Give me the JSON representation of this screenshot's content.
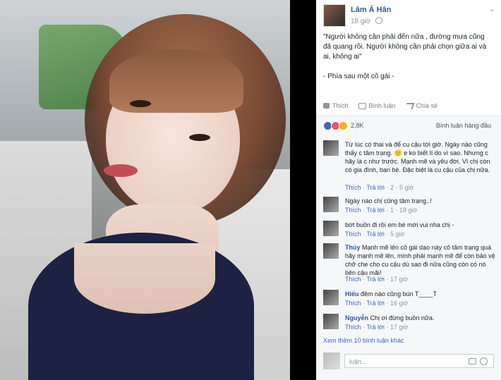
{
  "post": {
    "author": "Lâm Á Hân",
    "time": "18 giờ",
    "content": "\"Người không cần phải đến nữa , đường mưa cũng đã quang rồi. Người không cần phải chọn giữa ai và ai, không ai\"",
    "signature": "- Phía sau một cô gái -",
    "actions": {
      "like": "Thích",
      "comment": "Bình luận",
      "share": "Chia sẻ"
    },
    "reactions_count": "2,8K",
    "sort_label": "Bình luận hàng đầu",
    "chevron": "⌄"
  },
  "comments": [
    {
      "name": "",
      "text": "Từ lúc có thai và để cu cậu tới giờ. Ngày nào cũng thấy c tâm trạng. 🙂 e ko biết lí do vì sao. Nhưng c hãy là c như trước. Mạnh mẽ và yêu đời. Vì chị còn có gia đình, bạn bè. Đặc biệt là cu cậu của chị nữa.",
      "like": "Thích",
      "reply": "Trả lời",
      "likes": "2",
      "time": "5 giờ"
    },
    {
      "name": "",
      "text": "Ngày nào chị cũng tâm trạng..!",
      "like": "Thích",
      "reply": "Trả lời",
      "likes": "1",
      "time": "18 giờ"
    },
    {
      "name": "",
      "text": "bớt buồn đi rồi em bé mới vui nha chị -",
      "like": "Thích",
      "reply": "Trả lời",
      "time": "5 giờ"
    },
    {
      "name": "Thủy",
      "text": "Mạnh mẽ lên cô gái dạo này cô tâm trạng quá hãy mạnh mẽ lên, mình phải mạnh mẽ để còn bảo vệ chở che cho cu cậu dù sao đi nữa cũng còn có nó bên cậu mãi!",
      "like": "Thích",
      "reply": "Trả lời",
      "time": "17 giờ"
    },
    {
      "name": "Hiếu",
      "text": "đêm nào cũng bún T____T",
      "like": "Thích",
      "reply": "Trả lời",
      "time": "16 giờ"
    },
    {
      "name": "Nguyễn",
      "text": "Chị ơi đừng buồn nữa.",
      "like": "Thích",
      "reply": "Trả lời",
      "time": "17 giờ"
    }
  ],
  "more_comments": "Xem thêm 10 bình luận khác",
  "compose_placeholder": "luận..."
}
